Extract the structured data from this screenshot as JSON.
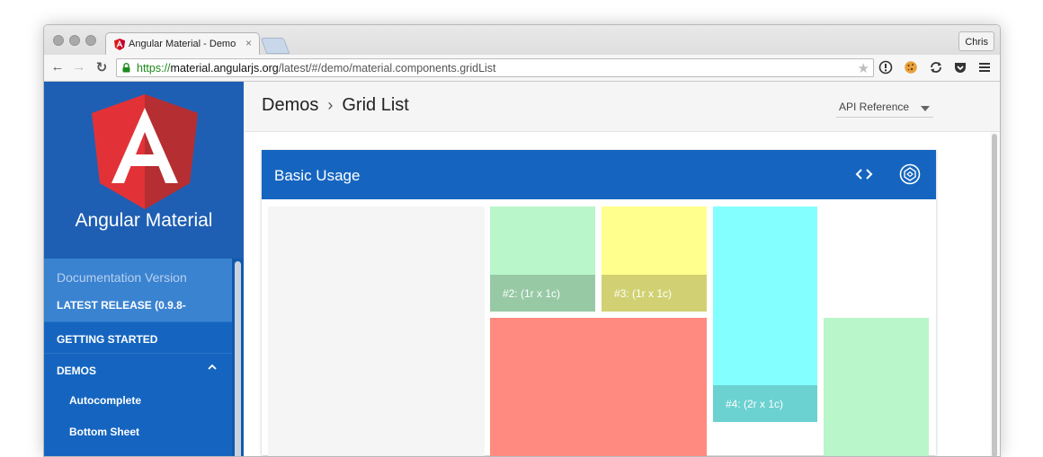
{
  "browser": {
    "tab_title": "Angular Material - Demos",
    "tab_close": "×",
    "profile_name": "Chris",
    "url_scheme": "https://",
    "url_host": "material.angularjs.org",
    "url_path": "/latest/#/demo/material.components.gridList",
    "nav": {
      "back": "←",
      "forward": "→",
      "reload": "↻"
    },
    "star": "★"
  },
  "sidebar": {
    "brand": "Angular Material",
    "doc_version_label": "Documentation Version",
    "doc_version_value": "LATEST RELEASE (0.9.8-",
    "items": [
      {
        "label": "GETTING STARTED"
      },
      {
        "label": "DEMOS"
      }
    ],
    "demo_children": [
      {
        "label": "Autocomplete"
      },
      {
        "label": "Bottom Sheet"
      }
    ]
  },
  "header": {
    "crumb_1": "Demos",
    "crumb_sep": "›",
    "crumb_2": "Grid List",
    "api_reference": "API Reference"
  },
  "demo": {
    "title": "Basic Usage",
    "tiles": [
      {
        "label": ""
      },
      {
        "label": "#2: (1r x 1c)"
      },
      {
        "label": "#3: (1r x 1c)"
      },
      {
        "label": "#4: (2r x 1c)"
      },
      {
        "label": ""
      },
      {
        "label": ""
      }
    ]
  },
  "colors": {
    "brand_blue": "#1565c0",
    "tile_gray": "#f5f5f5",
    "tile_green": "#b9f6ca",
    "tile_yellow": "#ffff8d",
    "tile_cyan": "#84ffff",
    "tile_red": "#ff8a80"
  }
}
